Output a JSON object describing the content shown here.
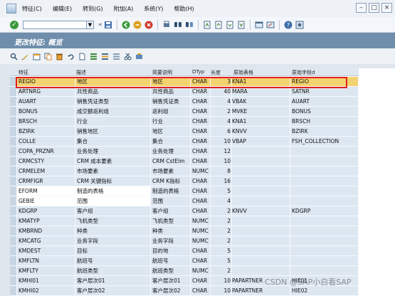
{
  "menu": [
    "特征(C)",
    "编辑(E)",
    "转到(G)",
    "附加(A)",
    "系统(Y)",
    "帮助(H)"
  ],
  "page_title": "更改特征: 概览",
  "table": {
    "headers": [
      "特征",
      "描述",
      "简要说明",
      "DTyp",
      "长度",
      "原始表格",
      "原始字段d"
    ],
    "rows": [
      {
        "feature": "REGIO",
        "desc": "地区",
        "short": "地区",
        "dtyp": "CHAR",
        "len": "3",
        "table": "KNA1",
        "field": "REGIO",
        "selected": true
      },
      {
        "feature": "ARTNRG",
        "desc": "共性商品",
        "short": "共性商品",
        "dtyp": "CHAR",
        "len": "40",
        "table": "MARA",
        "field": "SATNR"
      },
      {
        "feature": "AUART",
        "desc": "销售凭证类型",
        "short": "销售凭证类",
        "dtyp": "CHAR",
        "len": "4",
        "table": "VBAK",
        "field": "AUART"
      },
      {
        "feature": "BONUS",
        "desc": "成交额返利组",
        "short": "返利组",
        "dtyp": "CHAR",
        "len": "2",
        "table": "MVKE",
        "field": "BONUS"
      },
      {
        "feature": "BRSCH",
        "desc": "行业",
        "short": "行业",
        "dtyp": "CHAR",
        "len": "4",
        "table": "KNA1",
        "field": "BRSCH"
      },
      {
        "feature": "BZIRK",
        "desc": "销售地区",
        "short": "地区",
        "dtyp": "CHAR",
        "len": "6",
        "table": "KNVV",
        "field": "BZIRK"
      },
      {
        "feature": "COLLE",
        "desc": "集合",
        "short": "集合",
        "dtyp": "CHAR",
        "len": "10",
        "table": "VBAP",
        "field": "FSH_COLLECTION"
      },
      {
        "feature": "COPA_PRZNR",
        "desc": "业务处理",
        "short": "业务处理",
        "dtyp": "CHAR",
        "len": "12",
        "table": "",
        "field": ""
      },
      {
        "feature": "CRMCSTY",
        "desc": "CRM 成本要素",
        "short": "CRM CstElm",
        "dtyp": "CHAR",
        "len": "10",
        "table": "",
        "field": ""
      },
      {
        "feature": "CRMELEM",
        "desc": "市场要素",
        "short": "市场要素",
        "dtyp": "NUMC",
        "len": "8",
        "table": "",
        "field": ""
      },
      {
        "feature": "CRMFIGR",
        "desc": "CRM 关键指标",
        "short": "CRM K指标",
        "dtyp": "CHAR",
        "len": "16",
        "table": "",
        "field": ""
      },
      {
        "feature": "EFORM",
        "desc": "制造的表格",
        "short": "制造的表格",
        "dtyp": "CHAR",
        "len": "5",
        "table": "",
        "field": "",
        "white": true
      },
      {
        "feature": "GEBIE",
        "desc": "范围",
        "short": "范围",
        "dtyp": "CHAR",
        "len": "4",
        "table": "",
        "field": "",
        "white": true
      },
      {
        "feature": "KDGRP",
        "desc": "客户组",
        "short": "客户组",
        "dtyp": "CHAR",
        "len": "2",
        "table": "KNVV",
        "field": "KDGRP"
      },
      {
        "feature": "KMATYP",
        "desc": "飞机类型",
        "short": "飞机类型",
        "dtyp": "NUMC",
        "len": "2",
        "table": "",
        "field": ""
      },
      {
        "feature": "KMBRND",
        "desc": "种类",
        "short": "种类",
        "dtyp": "NUMC",
        "len": "2",
        "table": "",
        "field": ""
      },
      {
        "feature": "KMCATG",
        "desc": "业务字段",
        "short": "业务字段",
        "dtyp": "NUMC",
        "len": "2",
        "table": "",
        "field": ""
      },
      {
        "feature": "KMDEST",
        "desc": "目标",
        "short": "目的地",
        "dtyp": "CHAR",
        "len": "5",
        "table": "",
        "field": ""
      },
      {
        "feature": "KMFLTN",
        "desc": "航班号",
        "short": "航班号",
        "dtyp": "CHAR",
        "len": "5",
        "table": "",
        "field": ""
      },
      {
        "feature": "KMFLTY",
        "desc": "航班类型",
        "short": "航班类型",
        "dtyp": "NUMC",
        "len": "2",
        "table": "",
        "field": ""
      },
      {
        "feature": "KMHI01",
        "desc": "客户层次01",
        "short": "客户层次01",
        "dtyp": "CHAR",
        "len": "10",
        "table": "PAPARTNER",
        "field": "HIE01"
      },
      {
        "feature": "KMHI02",
        "desc": "客户层次02",
        "short": "客户层次02",
        "dtyp": "CHAR",
        "len": "10",
        "table": "PAPARTNER",
        "field": "HIE02"
      }
    ]
  },
  "watermark": "CSDN @SAP小白看SAP"
}
